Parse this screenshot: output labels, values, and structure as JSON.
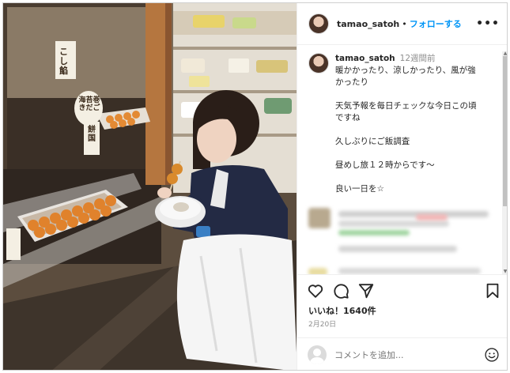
{
  "header": {
    "username": "tamao_satoh",
    "separator": "•",
    "follow_label": "フォローする",
    "more_label": "•••"
  },
  "caption": {
    "username": "tamao_satoh",
    "time": "12週間前",
    "lines": [
      "暖かかったり、涼しかったり、風が強",
      "かったり",
      "",
      "天気予報を毎日チェックな今日この頃",
      "ですね",
      "",
      "久しぶりにご飯調査",
      "",
      "昼めし旅１２時からです〜",
      "",
      "良い一日を☆"
    ]
  },
  "photo": {
    "sign_1": "こし餡",
    "sign_2": "海苔巻きだご",
    "sign_3": "餅国"
  },
  "actions": {
    "like_icon": "heart-icon",
    "comment_icon": "comment-icon",
    "share_icon": "share-icon",
    "save_icon": "bookmark-icon"
  },
  "likes": "いいね！1640件",
  "date": "2月20日",
  "comment_box": {
    "placeholder": "コメントを追加...",
    "emoji_icon": "smiley-icon"
  },
  "colors": {
    "link_blue": "#0095f6",
    "text": "#262626",
    "muted": "#8e8e8e"
  }
}
